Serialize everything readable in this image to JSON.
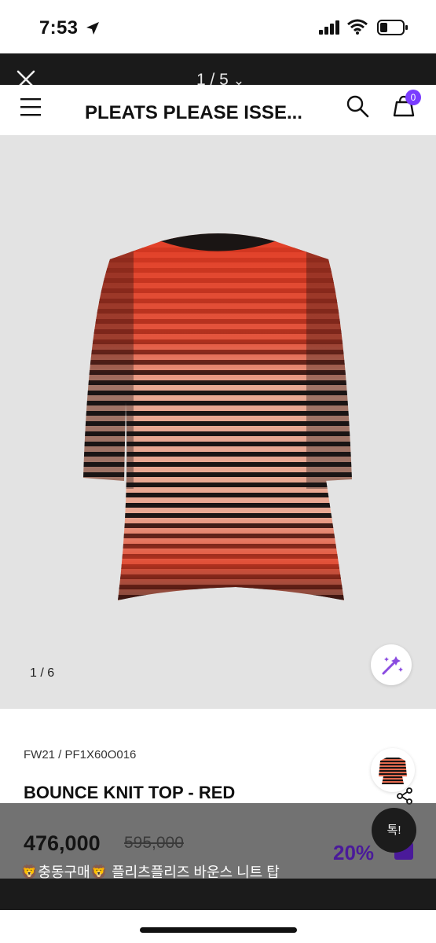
{
  "status_bar": {
    "time": "7:53"
  },
  "viewer": {
    "counter": "1 / 5",
    "chevron": "⌄"
  },
  "header": {
    "title": "PLEATS PLEASE ISSE...",
    "cart_count": "0"
  },
  "gallery": {
    "counter": "1  / 6"
  },
  "product": {
    "code": "FW21 / PF1X60O016",
    "name": "BOUNCE KNIT TOP - RED",
    "price": "476,000",
    "original_price": "595,000",
    "discount": "20%",
    "caption": "🦁충동구매🦁 플리츠플리즈 바운스 니트 탑"
  },
  "chat": {
    "label": "톡!"
  },
  "colors": {
    "accent": "#7a3cff",
    "discount": "#4a1a9a",
    "stripe_red": "#e13a22",
    "stripe_black": "#1a1514",
    "stripe_peach": "#e9a892"
  }
}
